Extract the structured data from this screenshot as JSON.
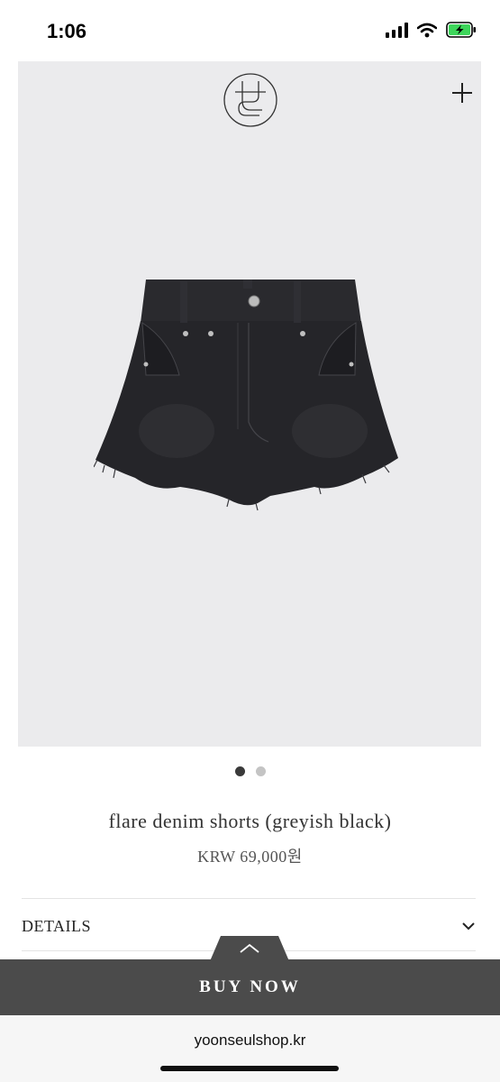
{
  "status_bar": {
    "time": "1:06"
  },
  "product": {
    "name": "flare denim shorts (greyish black)",
    "price": "KRW 69,000원",
    "image_count": 2,
    "active_image_index": 0
  },
  "sections": {
    "details_label": "DETAILS"
  },
  "actions": {
    "buy_label": "BUY NOW"
  },
  "browser": {
    "url": "yoonseulshop.kr"
  },
  "icons": [
    "brand-logo-icon",
    "plus-icon",
    "chevron-down-icon",
    "chevron-up-icon",
    "signal-icon",
    "wifi-icon",
    "battery-icon"
  ],
  "colors": {
    "buy_bar": "#4b4b4b",
    "hero_bg": "#ebebed",
    "battery_green": "#3dd55a"
  }
}
